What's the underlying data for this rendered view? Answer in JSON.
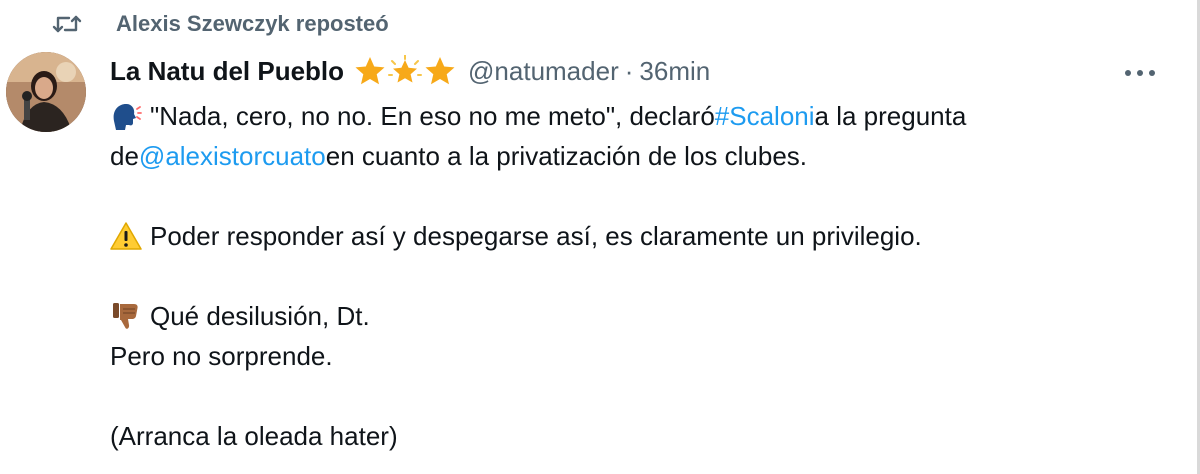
{
  "repost": {
    "icon": "repost-icon",
    "text": "Alexis Szewczyk reposteó"
  },
  "tweet": {
    "author": {
      "display_name": "La Natu del Pueblo",
      "badge_icons": [
        "star-icon",
        "sparkle-star-icon",
        "star-icon"
      ],
      "handle": "@natumader",
      "separator": "·",
      "time": "36min",
      "avatar_icon": "avatar-photo"
    },
    "more_icon": "more-options-icon",
    "paragraphs": {
      "p1": {
        "emoji": "speaking-head-icon",
        "text_a": "\"Nada, cero, no no. En eso no me meto\", declaró ",
        "hashtag": "#Scaloni",
        "text_b": " a la pregunta",
        "text_c": "de ",
        "mention": "@alexistorcuato",
        "text_d": " en cuanto a la privatización de los clubes."
      },
      "p2": {
        "emoji": "warning-icon",
        "text": "Poder responder así y despegarse así, es claramente un privilegio."
      },
      "p3": {
        "emoji": "thumbs-down-icon",
        "line1": "Qué desilusión, Dt.",
        "line2": "Pero no sorprende."
      },
      "p4": {
        "text": "(Arranca la oleada hater)"
      }
    },
    "colors": {
      "link": "#1d9bf0",
      "secondary": "#536471",
      "text": "#0f1419"
    }
  }
}
